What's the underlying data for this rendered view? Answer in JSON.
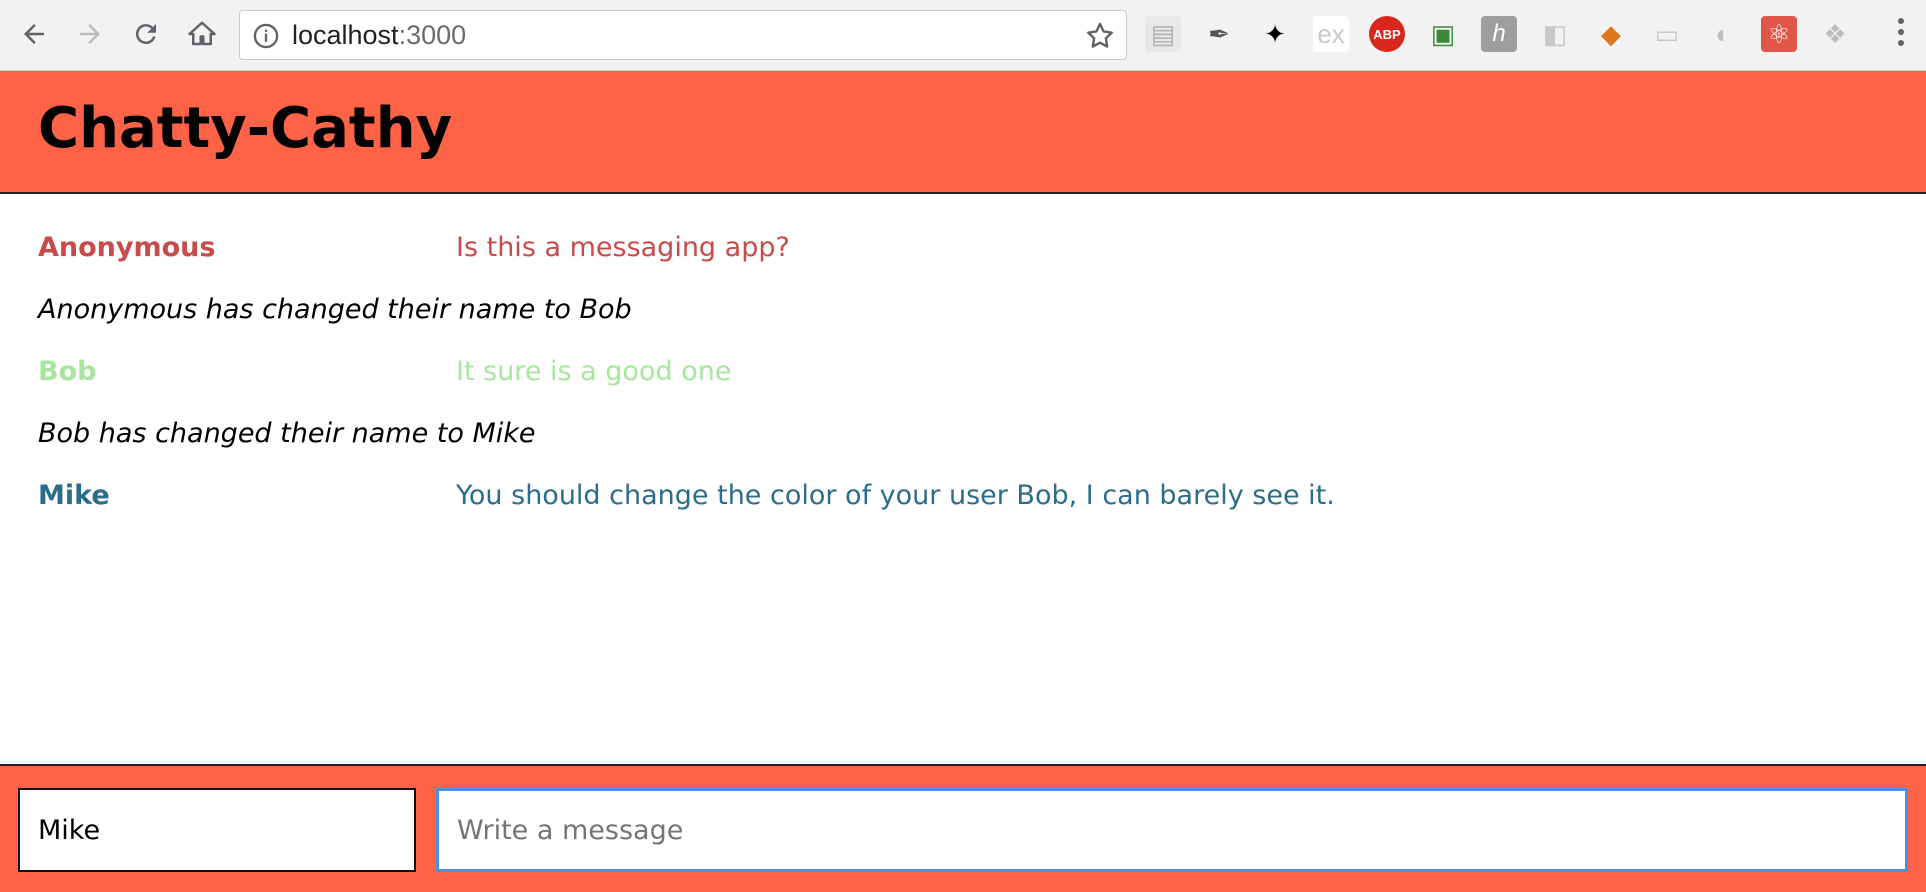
{
  "browser": {
    "url_host": "localhost",
    "url_port": ":3000",
    "extensions": [
      {
        "icon": "save-page-icon",
        "label": ""
      },
      {
        "icon": "eyedropper-icon",
        "label": ""
      },
      {
        "icon": "ninja-icon",
        "label": ""
      },
      {
        "icon": "ex-icon",
        "label": "ex"
      },
      {
        "icon": "adblock-plus-icon",
        "label": "ABP"
      },
      {
        "icon": "network-icon",
        "label": ""
      },
      {
        "icon": "h-icon",
        "label": "h"
      },
      {
        "icon": "camera-icon",
        "label": ""
      },
      {
        "icon": "metamask-fox-icon",
        "label": ""
      },
      {
        "icon": "card-icon",
        "label": ""
      },
      {
        "icon": "swirl-icon",
        "label": ""
      },
      {
        "icon": "react-devtools-icon",
        "label": ""
      },
      {
        "icon": "dropbox-icon",
        "label": ""
      }
    ]
  },
  "app": {
    "title": "Chatty-Cathy"
  },
  "messages": [
    {
      "type": "message",
      "username": "Anonymous",
      "content": "Is this a messaging app?",
      "color": "#c94a4a"
    },
    {
      "type": "notification",
      "content": "Anonymous has changed their name to Bob"
    },
    {
      "type": "message",
      "username": "Bob",
      "content": "It sure is a good one",
      "color": "#a8e6a0"
    },
    {
      "type": "notification",
      "content": "Bob has changed their name to Mike"
    },
    {
      "type": "message",
      "username": "Mike",
      "content": "You should change the color of your user Bob, I can barely see it.",
      "color": "#2c6d8a"
    }
  ],
  "chatbar": {
    "username_value": "Mike",
    "message_placeholder": "Write a message",
    "message_value": ""
  },
  "colors": {
    "accent": "#ff6347",
    "focus_ring": "#4a90e2"
  }
}
